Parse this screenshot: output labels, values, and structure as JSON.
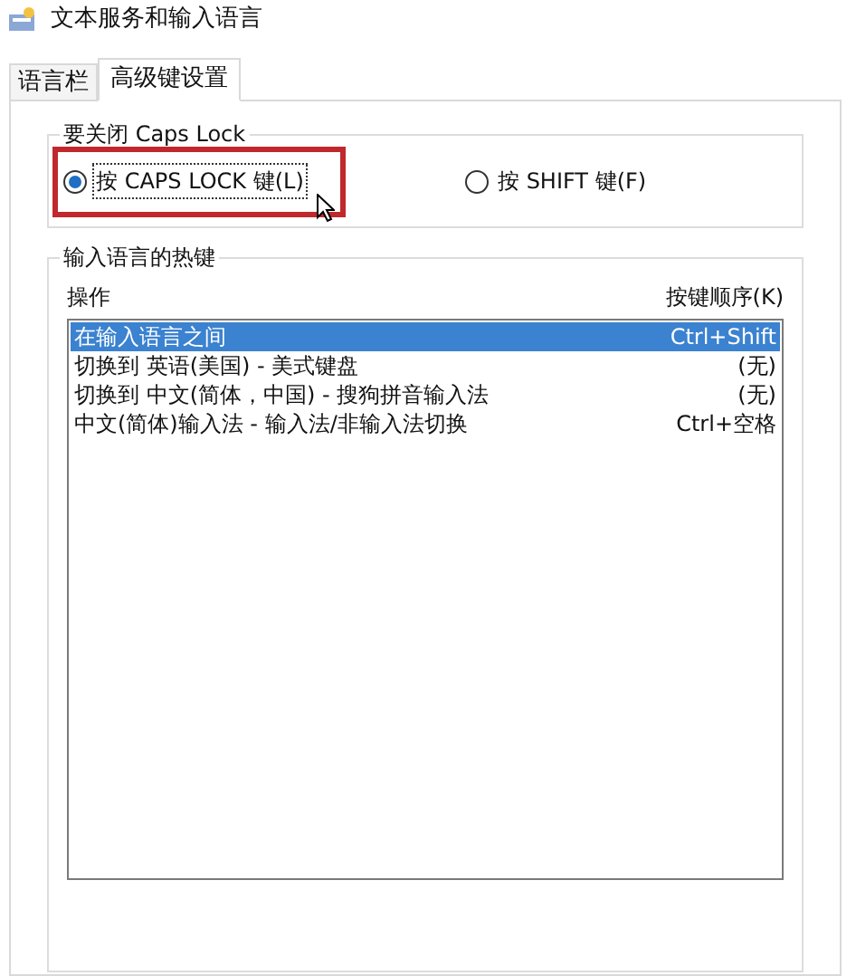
{
  "window": {
    "title": "文本服务和输入语言"
  },
  "tabs": [
    {
      "label": "语言栏",
      "selected": false
    },
    {
      "label": "高级键设置",
      "selected": true
    }
  ],
  "caps_lock_group": {
    "title": "要关闭 Caps Lock",
    "options": [
      {
        "label": "按 CAPS LOCK 键(L)",
        "selected": true,
        "highlighted": true
      },
      {
        "label": "按 SHIFT 键(F)",
        "selected": false,
        "highlighted": false
      }
    ]
  },
  "hotkeys_group": {
    "title": "输入语言的热键",
    "columns": [
      "操作",
      "按键顺序(K)"
    ],
    "rows": [
      {
        "action": "在输入语言之间",
        "keys": "Ctrl+Shift",
        "selected": true
      },
      {
        "action": "切换到 英语(美国) - 美式键盘",
        "keys": "(无)",
        "selected": false
      },
      {
        "action": "切换到 中文(简体，中国) - 搜狗拼音输入法",
        "keys": "(无)",
        "selected": false
      },
      {
        "action": "中文(简体)输入法 - 输入法/非输入法切换",
        "keys": "Ctrl+空格",
        "selected": false
      }
    ]
  }
}
